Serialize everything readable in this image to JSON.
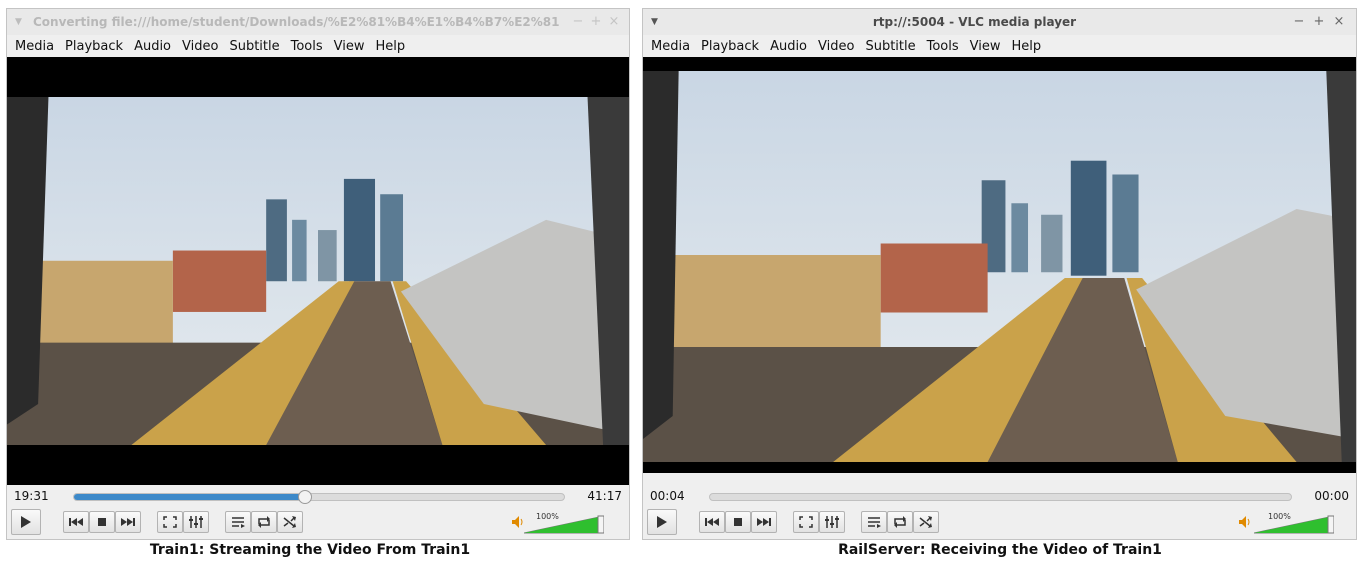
{
  "left_window": {
    "title": "Converting file:///home/student/Downloads/%E2%81%B4%E1%B4%B7%E2%81%9",
    "menu": [
      "Media",
      "Playback",
      "Audio",
      "Video",
      "Subtitle",
      "Tools",
      "View",
      "Help"
    ],
    "time_current": "19:31",
    "time_total": "41:17",
    "progress": 0.47,
    "volume_label": "100%",
    "volume_level": 1.0,
    "caption": "Train1: Streaming the Video From Train1"
  },
  "right_window": {
    "title": "rtp://:5004 - VLC media player",
    "menu": [
      "Media",
      "Playback",
      "Audio",
      "Video",
      "Subtitle",
      "Tools",
      "View",
      "Help"
    ],
    "time_current": "00:04",
    "time_total": "00:00",
    "progress": 0.0,
    "volume_label": "100%",
    "volume_level": 1.0,
    "caption": "RailServer: Receiving the Video of Train1"
  },
  "window_controls": [
    "−",
    "+",
    "×"
  ],
  "icons": {
    "menu": "down-triangle-icon",
    "play": "play-icon",
    "previous": "skip-back-icon",
    "stop": "stop-icon",
    "next": "skip-forward-icon",
    "fullscreen": "fullscreen-icon",
    "extended": "equalizer-icon",
    "playlist": "playlist-icon",
    "loop": "loop-icon",
    "shuffle": "shuffle-icon",
    "volume": "speaker-icon"
  },
  "colors": {
    "seek_fill": "#3c89c9",
    "volume_fill": "#2fbf2f"
  }
}
